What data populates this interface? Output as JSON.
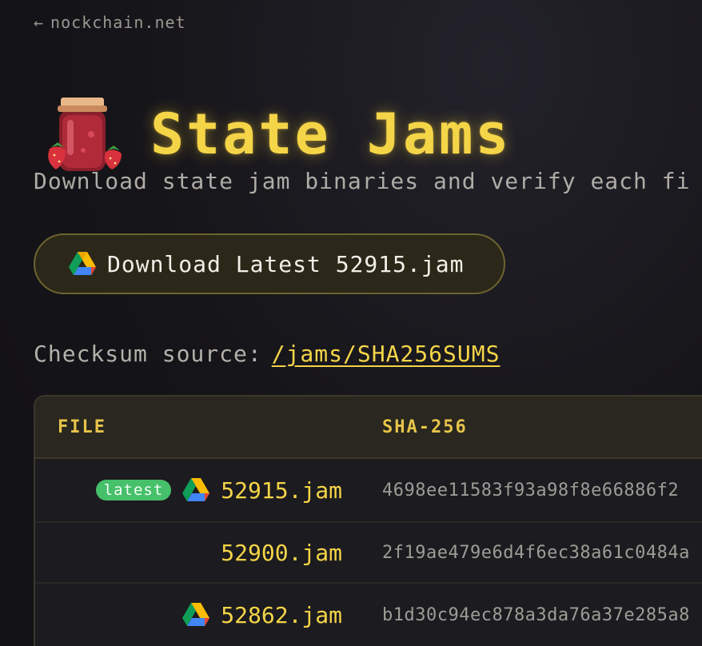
{
  "nav": {
    "back_arrow": "←",
    "back_label": "nockchain.net"
  },
  "header": {
    "title": "State Jams",
    "icon": "jam-jar-icon"
  },
  "subtitle": "Download state jam binaries and verify each fi",
  "download_button": {
    "label": "Download Latest 52915.jam",
    "icon": "google-drive-icon"
  },
  "checksum": {
    "label": "Checksum source:",
    "link_text": "/jams/SHA256SUMS"
  },
  "table": {
    "columns": [
      "FILE",
      "SHA-256"
    ],
    "rows": [
      {
        "badge": "latest",
        "drive_icon": true,
        "file": "52915.jam",
        "sha": "4698ee11583f93a98f8e66886f2"
      },
      {
        "badge": "",
        "drive_icon": false,
        "file": "52900.jam",
        "sha": "2f19ae479e6d4f6ec38a61c0484a"
      },
      {
        "badge": "",
        "drive_icon": true,
        "file": "52862.jam",
        "sha": "b1d30c94ec878a3da76a37e285a8"
      }
    ]
  },
  "colors": {
    "accent": "#f5d548",
    "badge_green": "#46c06a",
    "background": "#141317"
  }
}
